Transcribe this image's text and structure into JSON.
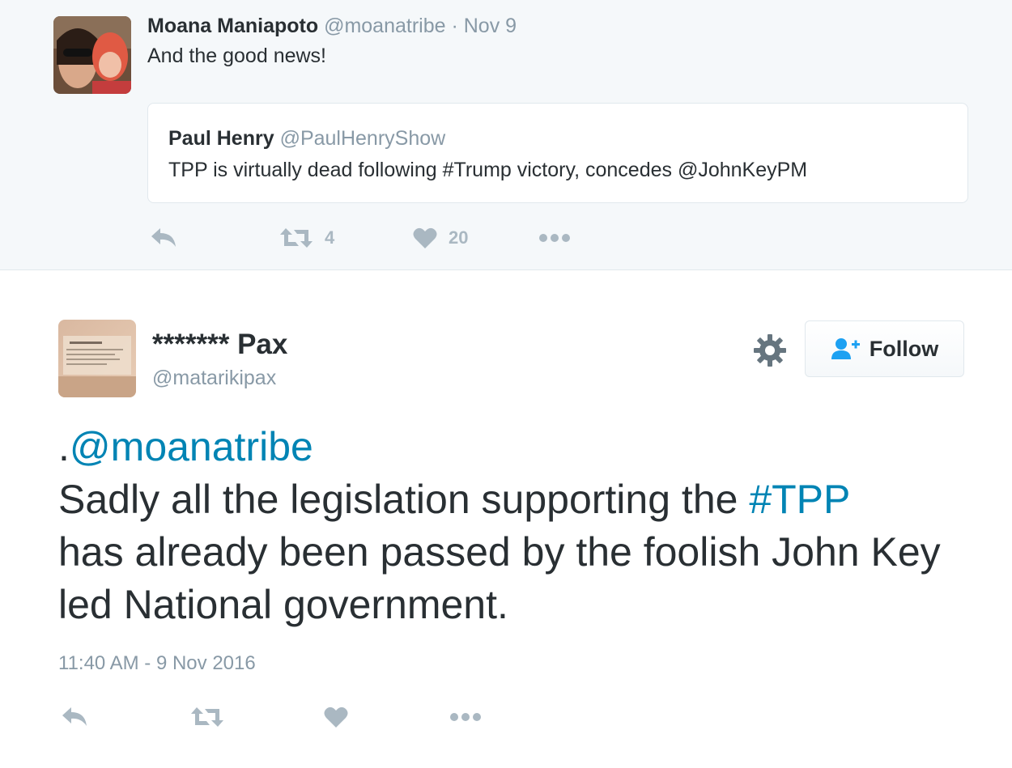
{
  "parent_tweet": {
    "author_name": "Moana Maniapoto",
    "author_handle": "@moanatribe",
    "separator": "·",
    "date": "Nov 9",
    "text": "And the good news!",
    "quoted": {
      "author_name": "Paul Henry",
      "author_handle": "@PaulHenryShow",
      "text": "TPP is virtually dead following #Trump victory, concedes @JohnKeyPM"
    },
    "actions": {
      "retweet_count": "4",
      "like_count": "20"
    }
  },
  "main_tweet": {
    "author_name": "******* Pax",
    "author_handle": "@matarikipax",
    "follow_label": "Follow",
    "text": {
      "prefix": ".",
      "mention": "@moanatribe",
      "part1": "Sadly all the legislation supporting the ",
      "hashtag": "#TPP",
      "part2": "has already been passed by the foolish John Key led National government."
    },
    "timestamp": "11:40 AM - 9 Nov 2016"
  },
  "colors": {
    "link": "#0084b4",
    "muted": "#8899a6",
    "icon": "#aab8c2",
    "text": "#292f33",
    "parent_bg": "#f5f8fa",
    "border": "#e1e8ed"
  },
  "icons": {
    "reply": "reply-icon",
    "retweet": "retweet-icon",
    "like": "heart-icon",
    "more": "more-icon",
    "settings": "gear-icon",
    "follow": "add-user-icon"
  }
}
